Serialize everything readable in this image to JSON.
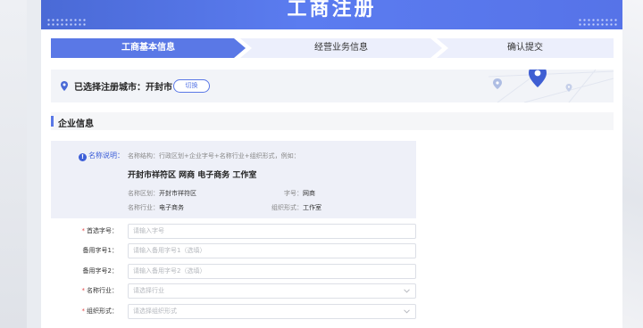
{
  "banner": {
    "title": "工商注册"
  },
  "steps": [
    {
      "label": "工商基本信息",
      "active": true
    },
    {
      "label": "经营业务信息",
      "active": false
    },
    {
      "label": "确认提交",
      "active": false
    }
  ],
  "city": {
    "label": "已选择注册城市：开封市",
    "switch_label": "切换"
  },
  "section": {
    "title": "企业信息"
  },
  "name_rule": {
    "label": "名称说明：",
    "structure": "名称结构：行政区划+企业字号+名称行业+组织形式，例如：",
    "example": "开封市祥符区 网商 电子商务 工作室",
    "region_key": "名称区划：",
    "region_val": "开封市祥符区",
    "brand_key": "字号：",
    "brand_val": "网商",
    "industry_key": "名称行业：",
    "industry_val": "电子商务",
    "form_key": "组织形式：",
    "form_val": "工作室"
  },
  "form": {
    "fields": [
      {
        "label": "首选字号：",
        "required": true,
        "placeholder": "请输入字号",
        "type": "input"
      },
      {
        "label": "备用字号1：",
        "required": false,
        "placeholder": "请输入备用字号1（选填）",
        "type": "input"
      },
      {
        "label": "备用字号2：",
        "required": false,
        "placeholder": "请输入备用字号2（选填）",
        "type": "input"
      },
      {
        "label": "名称行业：",
        "required": true,
        "placeholder": "请选择行业",
        "type": "select"
      },
      {
        "label": "组织形式：",
        "required": true,
        "placeholder": "请选择组织形式",
        "type": "select"
      }
    ]
  },
  "colors": {
    "accent": "#5a78e6",
    "required": "#e34b4b"
  },
  "icons": {
    "location": "location-pin-icon",
    "info": "info-circle-icon",
    "chevron": "chevron-down-icon"
  }
}
